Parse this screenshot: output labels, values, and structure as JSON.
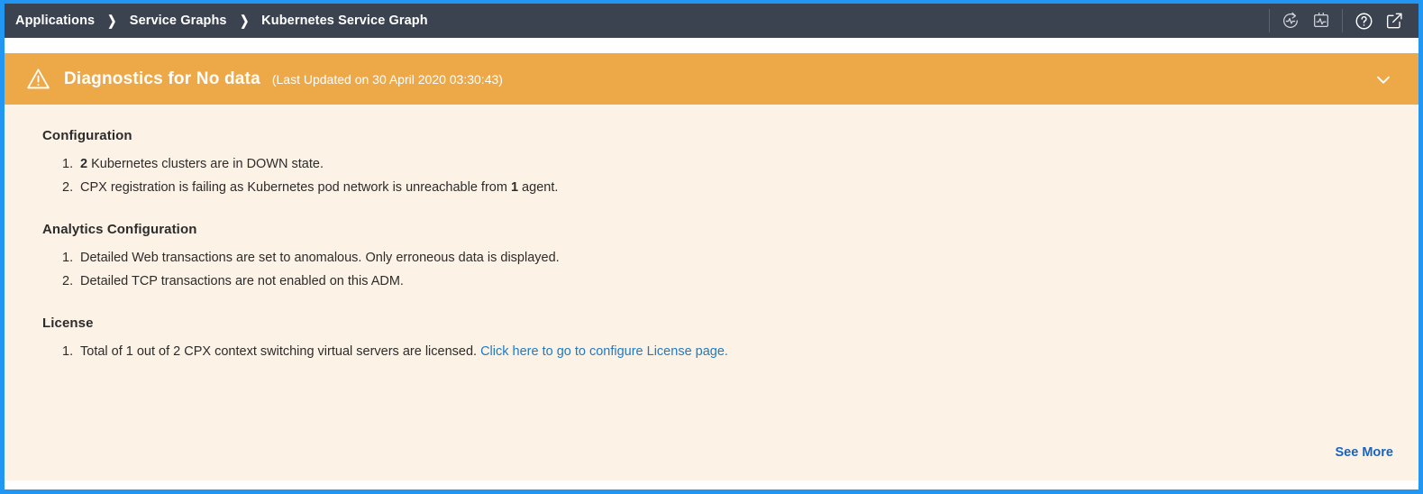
{
  "colors": {
    "header_bg": "#3b4250",
    "frame_border": "#2196f3",
    "banner_bg": "#eda847",
    "content_bg": "#fdf2e6",
    "link": "#1f7ac4",
    "see_more": "#1565c0",
    "text": "#2c2c2c"
  },
  "header": {
    "breadcrumb": [
      {
        "label": "Applications"
      },
      {
        "label": "Service Graphs"
      },
      {
        "label": "Kubernetes Service Graph"
      }
    ],
    "separator": "❯",
    "icons": [
      {
        "name": "refresh-metrics-icon",
        "title": "Refresh Metrics"
      },
      {
        "name": "chart-box-icon",
        "title": "Metrics"
      },
      {
        "name": "help-icon",
        "title": "Help"
      },
      {
        "name": "external-link-icon",
        "title": "Open in new window"
      }
    ]
  },
  "banner": {
    "icon": "warning-triangle-icon",
    "title": "Diagnostics for No data",
    "subtitle": "(Last Updated on 30 April 2020 03:30:43)",
    "toggle_icon": "chevron-down-icon"
  },
  "sections": [
    {
      "title": "Configuration",
      "items": [
        {
          "number": "1.",
          "parts": [
            {
              "text": "2",
              "style": "bold"
            },
            {
              "text": " Kubernetes clusters are in DOWN state.",
              "style": "normal"
            }
          ]
        },
        {
          "number": "2.",
          "parts": [
            {
              "text": "CPX registration is failing as Kubernetes pod network is unreachable from ",
              "style": "normal"
            },
            {
              "text": "1",
              "style": "bold"
            },
            {
              "text": " agent.",
              "style": "normal"
            }
          ]
        }
      ]
    },
    {
      "title": "Analytics Configuration",
      "items": [
        {
          "number": "1.",
          "parts": [
            {
              "text": "Detailed Web transactions are set to anomalous. Only erroneous data is displayed.",
              "style": "normal"
            }
          ]
        },
        {
          "number": "2.",
          "parts": [
            {
              "text": "Detailed TCP transactions are not enabled on this ADM.",
              "style": "normal"
            }
          ]
        }
      ]
    },
    {
      "title": "License",
      "items": [
        {
          "number": "1.",
          "parts": [
            {
              "text": "Total of 1 out of 2 CPX context switching virtual servers are licensed. ",
              "style": "normal"
            },
            {
              "text": "Click here to go to configure License page.",
              "style": "link"
            }
          ]
        }
      ]
    }
  ],
  "footer": {
    "see_more_label": "See More"
  }
}
